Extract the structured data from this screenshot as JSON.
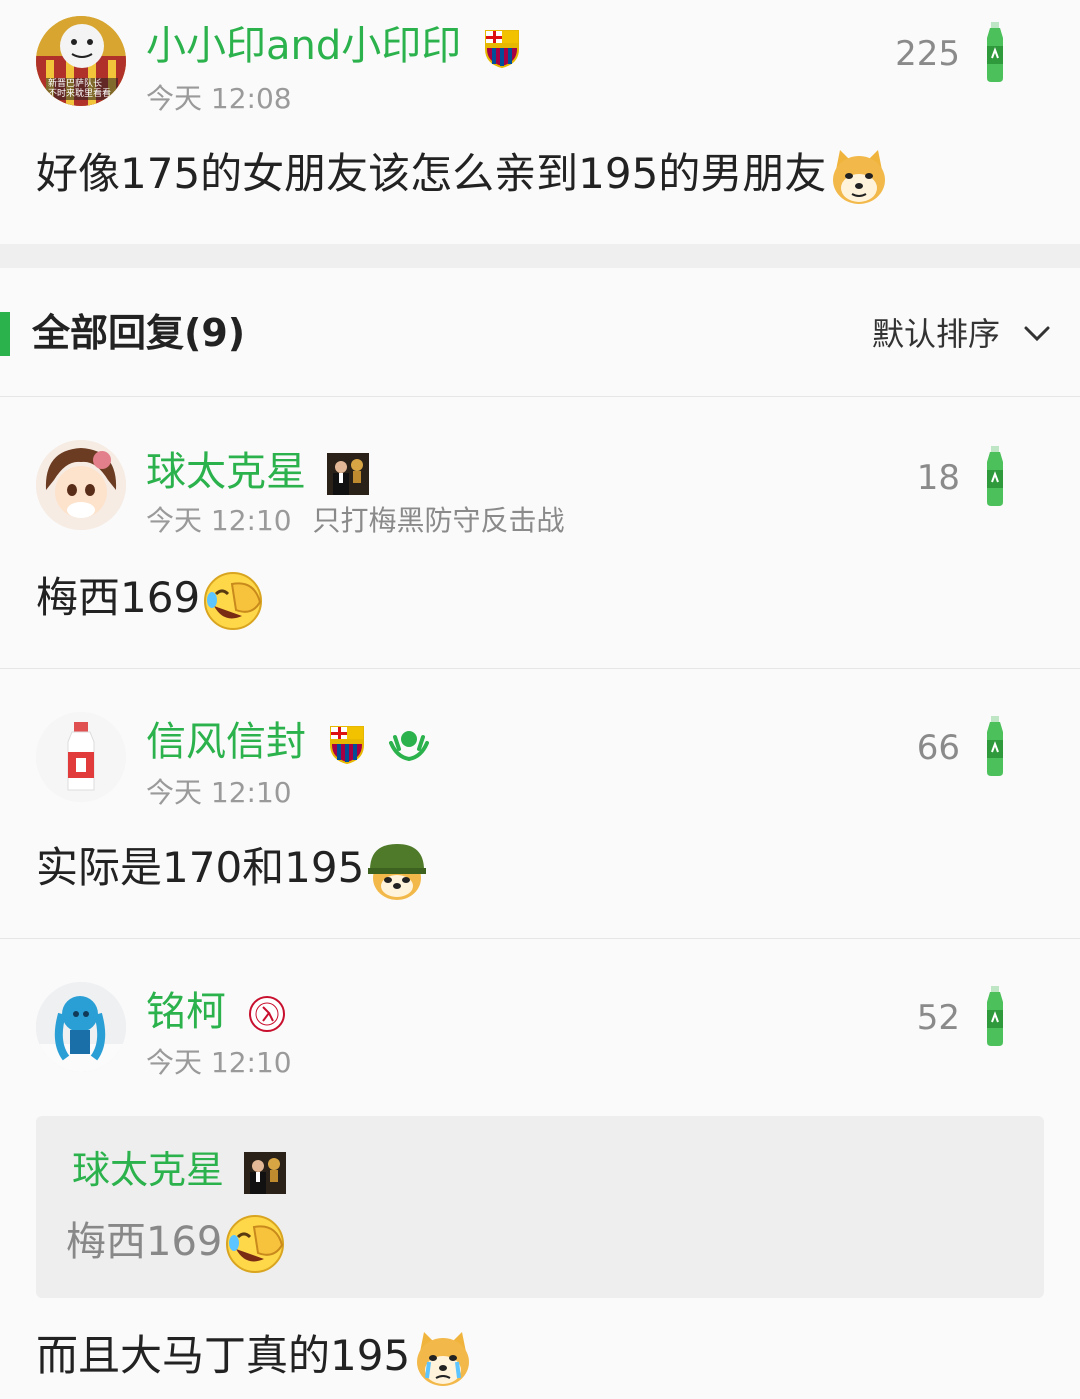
{
  "post": {
    "username": "小小印and小印印",
    "time": "今天 12:08",
    "likes": "225",
    "content": "好像175的女朋友该怎么亲到195的男朋友",
    "avatar_caption": [
      "新晋巴萨队长",
      "不时来耽里看看"
    ]
  },
  "replies_header": {
    "title": "全部回复(9)",
    "sort_label": "默认排序"
  },
  "replies": [
    {
      "username": "球太克星",
      "time": "今天 12:10",
      "extra": "只打梅黑防守反击战",
      "likes": "18",
      "content": "梅西169"
    },
    {
      "username": "信风信封",
      "time": "今天 12:10",
      "likes": "66",
      "content": "实际是170和195"
    },
    {
      "username": "铭柯",
      "time": "今天 12:10",
      "likes": "52",
      "quote": {
        "username": "球太克星",
        "content": "梅西169"
      },
      "content": "而且大马丁真的195"
    }
  ],
  "colors": {
    "accent_green": "#2bb24c",
    "background": "#fafafa",
    "quote_background": "#eeeeee",
    "meta_gray": "#9a9a9a"
  }
}
